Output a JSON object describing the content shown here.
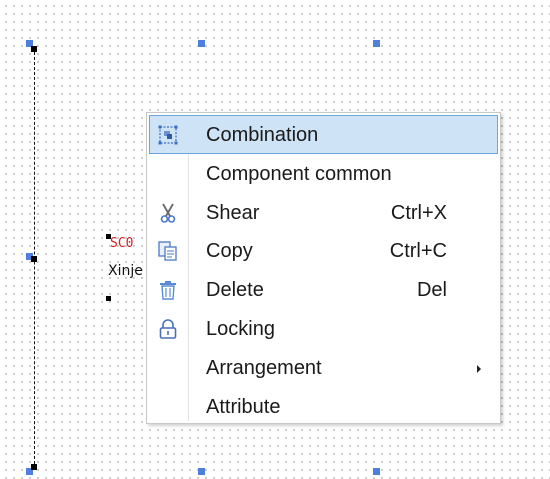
{
  "component": {
    "code_text": "SC0",
    "name_text": "Xinje"
  },
  "context_menu": {
    "items": [
      {
        "label": "Combination",
        "shortcut": "",
        "icon": "combination-icon",
        "highlighted": true
      },
      {
        "label": "Component common",
        "shortcut": "",
        "icon": "",
        "highlighted": false
      },
      {
        "label": "Shear",
        "shortcut": "Ctrl+X",
        "icon": "scissors-icon",
        "highlighted": false
      },
      {
        "label": "Copy",
        "shortcut": "Ctrl+C",
        "icon": "copy-icon",
        "highlighted": false
      },
      {
        "label": "Delete",
        "shortcut": "Del",
        "icon": "trash-icon",
        "highlighted": false
      },
      {
        "label": "Locking",
        "shortcut": "",
        "icon": "lock-icon",
        "highlighted": false
      },
      {
        "label": "Arrangement",
        "shortcut": "",
        "icon": "",
        "highlighted": false,
        "submenu": true
      },
      {
        "label": "Attribute",
        "shortcut": "",
        "icon": "",
        "highlighted": false
      }
    ]
  },
  "colors": {
    "highlight_bg": "#cfe3f7",
    "highlight_border": "#6aa5dc",
    "handle": "#4f7fdc",
    "component_code": "#d32020"
  }
}
